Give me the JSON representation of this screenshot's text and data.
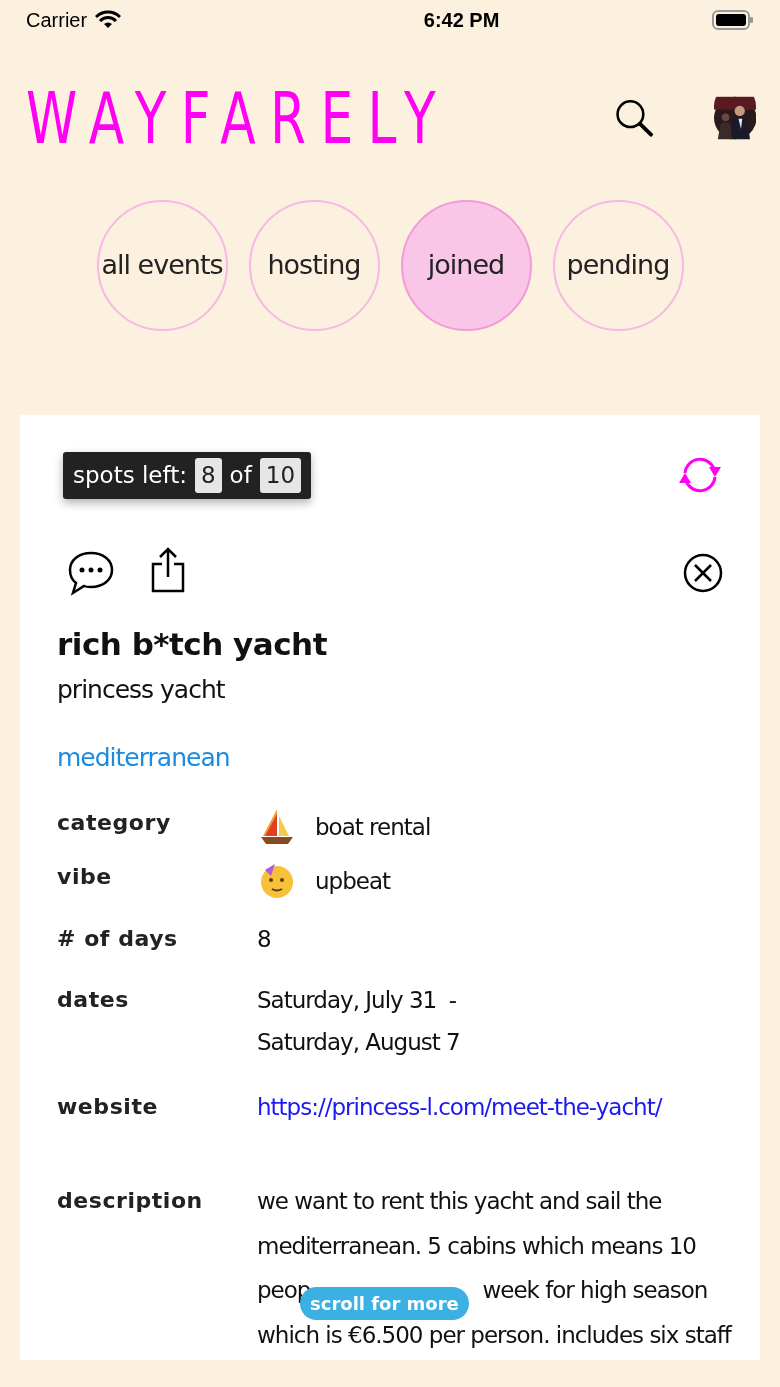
{
  "status_bar": {
    "carrier": "Carrier",
    "time": "6:42 PM"
  },
  "header": {
    "logo": "WAYFARELY"
  },
  "tabs": [
    {
      "label": "all events",
      "selected": false
    },
    {
      "label": "hosting",
      "selected": false
    },
    {
      "label": "joined",
      "selected": true
    },
    {
      "label": "pending",
      "selected": false
    }
  ],
  "event": {
    "spots_label": "spots left:",
    "spots_left": "8",
    "of": "of",
    "spots_total": "10",
    "title": "rich b*tch yacht",
    "subtitle": "princess yacht",
    "location": "mediterranean",
    "details": [
      {
        "label": "category",
        "value": "boat rental",
        "kind": "sailboat"
      },
      {
        "label": "vibe",
        "value": "upbeat",
        "kind": "party"
      },
      {
        "label": "# of days",
        "value": "8"
      },
      {
        "label": "dates",
        "lines": [
          "Saturday, July 31  -",
          "Saturday, August 7"
        ]
      },
      {
        "label": "website",
        "link": "https://princess-l.com/meet-the-yacht/"
      }
    ],
    "description": {
      "label": "description",
      "lines": [
        {
          "text": "we want to rent this yacht and sail the"
        },
        {
          "text": "mediterranean. 5 cabins which means 10"
        },
        {
          "start": "peop",
          "end": "week for high season"
        },
        {
          "text": "which is €6.500 per person. includes six staff"
        }
      ]
    }
  },
  "scroll_hint": "scroll for more"
}
